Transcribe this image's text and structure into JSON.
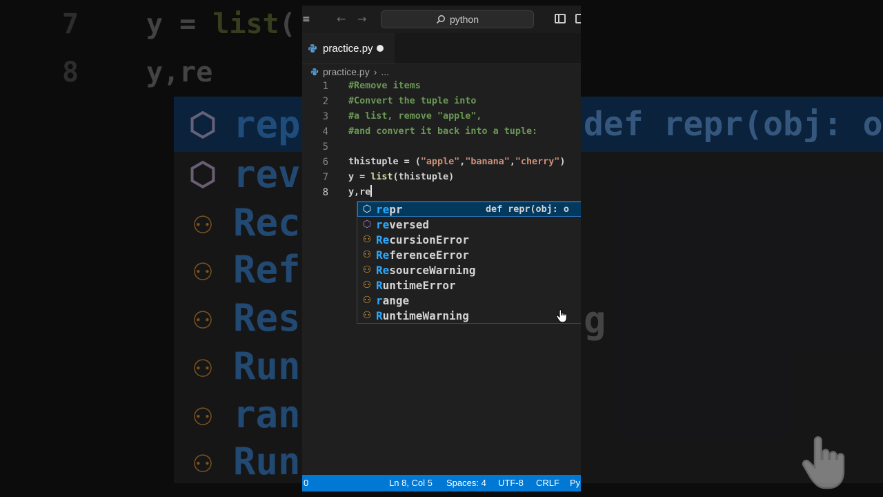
{
  "titlebar": {
    "menu_icon": "hamburger-icon",
    "back_icon": "arrow-left-icon",
    "forward_icon": "arrow-right-icon",
    "search_text": "python",
    "search_icon": "search-icon"
  },
  "tab": {
    "label": "practice.py",
    "dirty": true
  },
  "breadcrumb": {
    "file": "practice.py",
    "more": "..."
  },
  "code_lines": [
    {
      "n": "1",
      "text": "#Remove items"
    },
    {
      "n": "2",
      "text": "#Convert the tuple into"
    },
    {
      "n": "3",
      "text": "#a list, remove \"apple\","
    },
    {
      "n": "4",
      "text": "#and convert it back into a tuple:"
    },
    {
      "n": "5",
      "text": ""
    },
    {
      "n": "6",
      "text": "thistuple = (\"apple\",\"banana\",\"cherry\")"
    },
    {
      "n": "7",
      "text": "y = list(thistuple)"
    },
    {
      "n": "8",
      "text": "y,re"
    }
  ],
  "suggestions": [
    {
      "label": "repr",
      "match": "re",
      "rest": "pr",
      "icon": "cube-icon",
      "kind": "function",
      "detail": "def repr(obj: o"
    },
    {
      "label": "reversed",
      "match": "re",
      "rest": "versed",
      "icon": "cube-icon",
      "kind": "class"
    },
    {
      "label": "RecursionError",
      "match": "Re",
      "rest": "cursionError",
      "icon": "class-icon",
      "kind": "class"
    },
    {
      "label": "ReferenceError",
      "match": "Re",
      "rest": "ferenceError",
      "icon": "class-icon",
      "kind": "class"
    },
    {
      "label": "ResourceWarning",
      "match": "Re",
      "rest": "sourceWarning",
      "icon": "class-icon",
      "kind": "class"
    },
    {
      "label": "RuntimeError",
      "match": "R",
      "rest": "untimeError",
      "icon": "class-icon",
      "kind": "class"
    },
    {
      "label": "range",
      "match": "r",
      "rest": "ange",
      "icon": "class-icon",
      "kind": "class"
    },
    {
      "label": "RuntimeWarning",
      "match": "R",
      "rest": "untimeWarning",
      "icon": "class-icon",
      "kind": "class"
    }
  ],
  "statusbar": {
    "left": "0",
    "position": "Ln 8, Col 5",
    "spaces": "Spaces: 4",
    "encoding": "UTF-8",
    "eol": "CRLF",
    "language": "Py"
  },
  "background": {
    "line7_num": "7",
    "line7_code": "y = list(",
    "line8_num": "8",
    "line8_code": "y,re",
    "rows": [
      "rep",
      "rev",
      "Rec",
      "Ref",
      "Res",
      "Run",
      "ran",
      "Run"
    ],
    "detail": "def repr(obj: o",
    "trailing": "g"
  },
  "colors": {
    "statusbar": "#0078d4",
    "selected_row": "#04395e",
    "match_highlight": "#2aaaff",
    "comment": "#6a9955",
    "string": "#ce9178"
  }
}
